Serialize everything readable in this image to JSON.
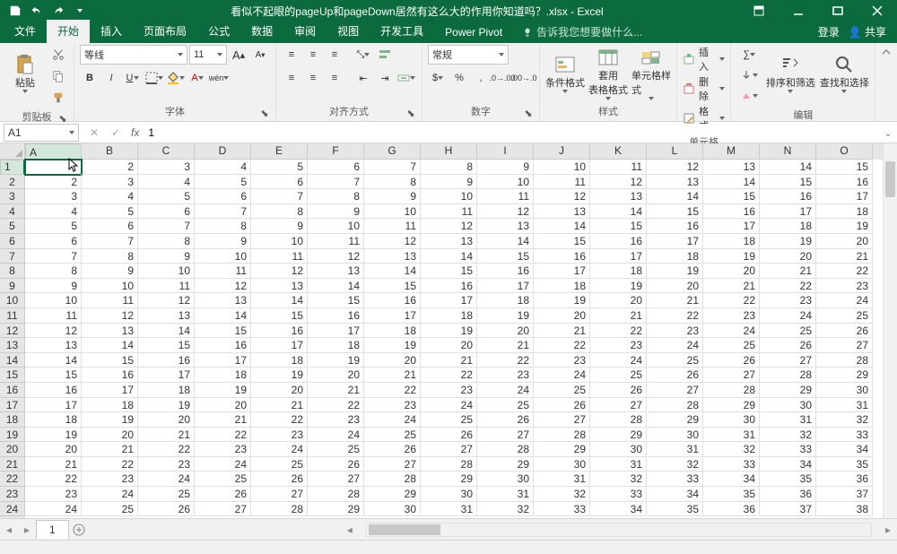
{
  "title": "看似不起眼的pageUp和pageDown居然有这么大的作用你知道吗？.xlsx - Excel",
  "tabs": {
    "file": "文件",
    "home": "开始",
    "insert": "插入",
    "layout": "页面布局",
    "formulas": "公式",
    "data": "数据",
    "review": "审阅",
    "view": "视图",
    "dev": "开发工具",
    "pivot": "Power Pivot",
    "tell": "告诉我您想要做什么...",
    "login": "登录",
    "share": "共享"
  },
  "ribbon": {
    "clipboard": "剪贴板",
    "paste": "粘贴",
    "font_group": "字体",
    "font_name": "等线",
    "font_size": "11",
    "align": "对齐方式",
    "number": "数字",
    "number_format": "常规",
    "styles": "样式",
    "cond_fmt": "条件格式",
    "table_fmt": "套用\n表格格式",
    "cell_style": "单元格样式",
    "cells": "单元格",
    "insert_cells": "插入",
    "delete_cells": "删除",
    "format_cells": "格式",
    "editing": "编辑",
    "sort_filter": "排序和筛选",
    "find_select": "查找和选择"
  },
  "name_box": "A1",
  "formula": "1",
  "columns": [
    "A",
    "B",
    "C",
    "D",
    "E",
    "F",
    "G",
    "H",
    "I",
    "J",
    "K",
    "L",
    "M",
    "N",
    "O"
  ],
  "rows": [
    "1",
    "2",
    "3",
    "4",
    "5",
    "6",
    "7",
    "8",
    "9",
    "10",
    "11",
    "12",
    "13",
    "14",
    "15",
    "16",
    "17",
    "18",
    "19",
    "20",
    "21",
    "22",
    "23",
    "24"
  ],
  "active_cell": {
    "row": 0,
    "col": 0
  },
  "sheet_tab": "1",
  "grid": [
    [
      1,
      2,
      3,
      4,
      5,
      6,
      7,
      8,
      9,
      10,
      11,
      12,
      13,
      14,
      15
    ],
    [
      2,
      3,
      4,
      5,
      6,
      7,
      8,
      9,
      10,
      11,
      12,
      13,
      14,
      15,
      16
    ],
    [
      3,
      4,
      5,
      6,
      7,
      8,
      9,
      10,
      11,
      12,
      13,
      14,
      15,
      16,
      17
    ],
    [
      4,
      5,
      6,
      7,
      8,
      9,
      10,
      11,
      12,
      13,
      14,
      15,
      16,
      17,
      18
    ],
    [
      5,
      6,
      7,
      8,
      9,
      10,
      11,
      12,
      13,
      14,
      15,
      16,
      17,
      18,
      19
    ],
    [
      6,
      7,
      8,
      9,
      10,
      11,
      12,
      13,
      14,
      15,
      16,
      17,
      18,
      19,
      20
    ],
    [
      7,
      8,
      9,
      10,
      11,
      12,
      13,
      14,
      15,
      16,
      17,
      18,
      19,
      20,
      21
    ],
    [
      8,
      9,
      10,
      11,
      12,
      13,
      14,
      15,
      16,
      17,
      18,
      19,
      20,
      21,
      22
    ],
    [
      9,
      10,
      11,
      12,
      13,
      14,
      15,
      16,
      17,
      18,
      19,
      20,
      21,
      22,
      23
    ],
    [
      10,
      11,
      12,
      13,
      14,
      15,
      16,
      17,
      18,
      19,
      20,
      21,
      22,
      23,
      24
    ],
    [
      11,
      12,
      13,
      14,
      15,
      16,
      17,
      18,
      19,
      20,
      21,
      22,
      23,
      24,
      25
    ],
    [
      12,
      13,
      14,
      15,
      16,
      17,
      18,
      19,
      20,
      21,
      22,
      23,
      24,
      25,
      26
    ],
    [
      13,
      14,
      15,
      16,
      17,
      18,
      19,
      20,
      21,
      22,
      23,
      24,
      25,
      26,
      27
    ],
    [
      14,
      15,
      16,
      17,
      18,
      19,
      20,
      21,
      22,
      23,
      24,
      25,
      26,
      27,
      28
    ],
    [
      15,
      16,
      17,
      18,
      19,
      20,
      21,
      22,
      23,
      24,
      25,
      26,
      27,
      28,
      29
    ],
    [
      16,
      17,
      18,
      19,
      20,
      21,
      22,
      23,
      24,
      25,
      26,
      27,
      28,
      29,
      30
    ],
    [
      17,
      18,
      19,
      20,
      21,
      22,
      23,
      24,
      25,
      26,
      27,
      28,
      29,
      30,
      31
    ],
    [
      18,
      19,
      20,
      21,
      22,
      23,
      24,
      25,
      26,
      27,
      28,
      29,
      30,
      31,
      32
    ],
    [
      19,
      20,
      21,
      22,
      23,
      24,
      25,
      26,
      27,
      28,
      29,
      30,
      31,
      32,
      33
    ],
    [
      20,
      21,
      22,
      23,
      24,
      25,
      26,
      27,
      28,
      29,
      30,
      31,
      32,
      33,
      34
    ],
    [
      21,
      22,
      23,
      24,
      25,
      26,
      27,
      28,
      29,
      30,
      31,
      32,
      33,
      34,
      35
    ],
    [
      22,
      23,
      24,
      25,
      26,
      27,
      28,
      29,
      30,
      31,
      32,
      33,
      34,
      35,
      36
    ],
    [
      23,
      24,
      25,
      26,
      27,
      28,
      29,
      30,
      31,
      32,
      33,
      34,
      35,
      36,
      37
    ],
    [
      24,
      25,
      26,
      27,
      28,
      29,
      30,
      31,
      32,
      33,
      34,
      35,
      36,
      37,
      38
    ]
  ]
}
